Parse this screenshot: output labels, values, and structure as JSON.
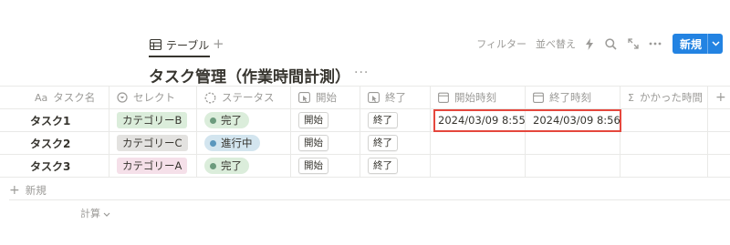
{
  "view_bar": {
    "tab_label": "テーブル",
    "add_view_symbol": "+",
    "filter_label": "フィルター",
    "sort_label": "並べ替え",
    "tool_icons": [
      "lightning-icon",
      "search-icon",
      "expand-icon",
      "more-icon"
    ],
    "new_button_label": "新規"
  },
  "database": {
    "title": "タスク管理（作業時間計測）",
    "more_label": "···"
  },
  "table": {
    "headers": [
      {
        "icon": "Aa",
        "label": "タスク名"
      },
      {
        "icon": "select-icon",
        "label": "セレクト"
      },
      {
        "icon": "status-icon",
        "label": "ステータス"
      },
      {
        "icon": "button-icon",
        "label": "開始"
      },
      {
        "icon": "button-icon",
        "label": "終了"
      },
      {
        "icon": "date-icon",
        "label": "開始時刻"
      },
      {
        "icon": "date-icon",
        "label": "終了時刻"
      },
      {
        "icon": "Σ",
        "label": "かかった時間"
      },
      {
        "icon": "+",
        "label": ""
      }
    ],
    "rows": [
      {
        "name": "タスク1",
        "category": "カテゴリーB",
        "category_color": "#dbeddb",
        "status": "完了",
        "status_bg": "#dbeddb",
        "status_dot": "#6c9b7d",
        "start_btn": "開始",
        "end_btn": "終了",
        "start_time": "2024/03/09 8:55",
        "end_time": "2024/03/09 8:56",
        "duration": ""
      },
      {
        "name": "タスク2",
        "category": "カテゴリーC",
        "category_color": "#e3e2e0",
        "status": "進行中",
        "status_bg": "#d3e5ef",
        "status_dot": "#5b97bd",
        "start_btn": "開始",
        "end_btn": "終了",
        "start_time": "",
        "end_time": "",
        "duration": ""
      },
      {
        "name": "タスク3",
        "category": "カテゴリーA",
        "category_color": "#f5e0e9",
        "status": "完了",
        "status_bg": "#dbeddb",
        "status_dot": "#6c9b7d",
        "start_btn": "開始",
        "end_btn": "終了",
        "start_time": "",
        "end_time": "",
        "duration": ""
      }
    ]
  },
  "footer": {
    "new_row_label": "新規",
    "calc_label": "計算"
  },
  "colors": {
    "accent": "#2383e2",
    "highlight_box": "#e5473d"
  }
}
